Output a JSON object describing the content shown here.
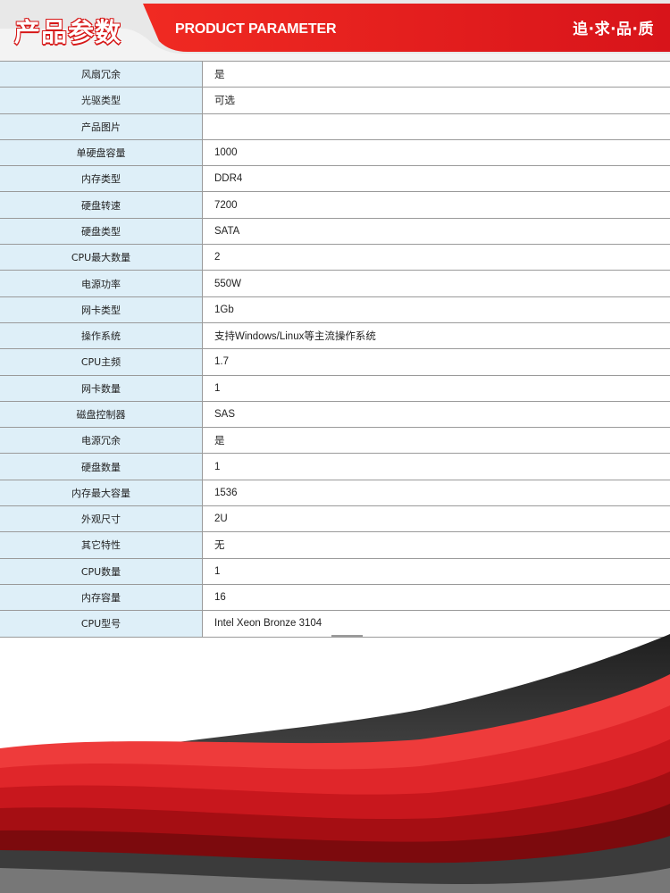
{
  "header": {
    "title_cn": "产品参数",
    "title_en": "PRODUCT PARAMETER",
    "slogan": "追·求·品·质"
  },
  "colors": {
    "brand_red": "#e21b1b",
    "label_bg": "#deeff8",
    "border": "#9a9a9a"
  },
  "params": [
    {
      "label": "风扇冗余",
      "value": "是"
    },
    {
      "label": "光驱类型",
      "value": "可选"
    },
    {
      "label": "产品图片",
      "value": ""
    },
    {
      "label": "单硬盘容量",
      "value": "1000"
    },
    {
      "label": "内存类型",
      "value": "DDR4"
    },
    {
      "label": "硬盘转速",
      "value": "7200"
    },
    {
      "label": "硬盘类型",
      "value": "SATA"
    },
    {
      "label": "CPU最大数量",
      "value": "2"
    },
    {
      "label": "电源功率",
      "value": "550W"
    },
    {
      "label": "网卡类型",
      "value": "1Gb"
    },
    {
      "label": "操作系统",
      "value": "支持Windows/Linux等主流操作系统"
    },
    {
      "label": "CPU主频",
      "value": "1.7"
    },
    {
      "label": "网卡数量",
      "value": "1"
    },
    {
      "label": "磁盘控制器",
      "value": "SAS"
    },
    {
      "label": "电源冗余",
      "value": "是"
    },
    {
      "label": "硬盘数量",
      "value": "1"
    },
    {
      "label": "内存最大容量",
      "value": "1536"
    },
    {
      "label": "外观尺寸",
      "value": "2U"
    },
    {
      "label": "其它特性",
      "value": "无"
    },
    {
      "label": "CPU数量",
      "value": "1"
    },
    {
      "label": "内存容量",
      "value": "16"
    },
    {
      "label": "CPU型号",
      "value": "Intel Xeon Bronze 3104"
    }
  ]
}
